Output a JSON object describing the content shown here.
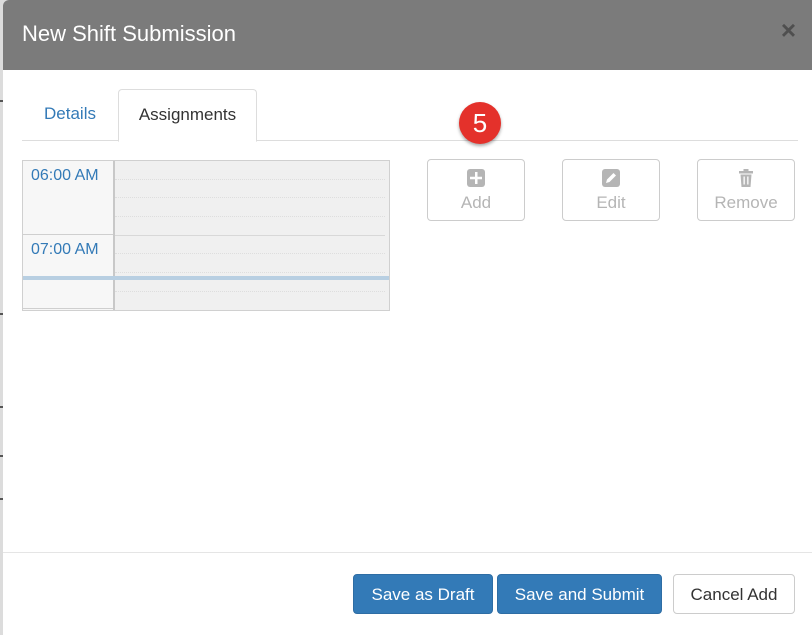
{
  "modal": {
    "title": "New Shift Submission",
    "close_glyph": "×"
  },
  "tabs": [
    {
      "label": "Details",
      "active": false
    },
    {
      "label": "Assignments",
      "active": true
    }
  ],
  "step_badge": "5",
  "calendar": {
    "time_slots": [
      "06:00 AM",
      "07:00 AM"
    ]
  },
  "actions": [
    {
      "label": "Add",
      "icon": "plus-square-icon",
      "enabled": false
    },
    {
      "label": "Edit",
      "icon": "pencil-icon",
      "enabled": false
    },
    {
      "label": "Remove",
      "icon": "trash-icon",
      "enabled": false
    }
  ],
  "footer": {
    "save_draft_label": "Save as Draft",
    "save_submit_label": "Save and Submit",
    "cancel_label": "Cancel Add"
  },
  "colors": {
    "header_bg": "#7b7b7b",
    "primary": "#337ab7",
    "badge": "#e4312b"
  }
}
